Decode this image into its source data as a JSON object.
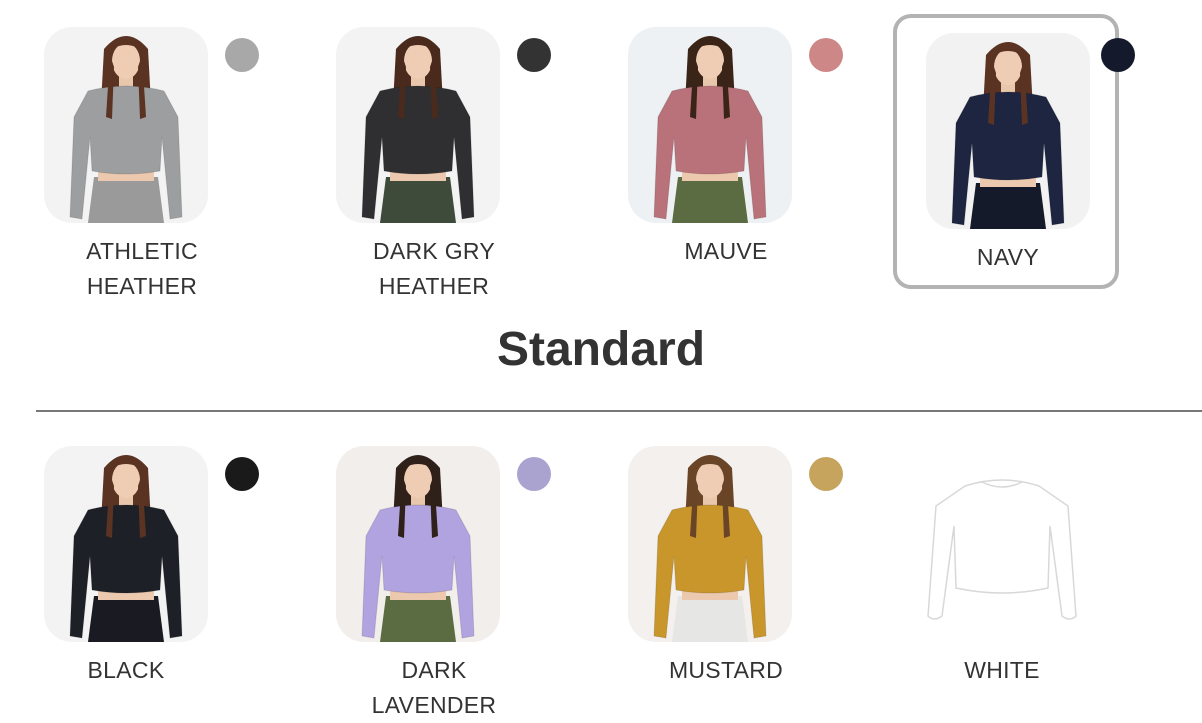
{
  "featured": [
    {
      "name": "ATHLETIC HEATHER",
      "line1": "ATHLETIC",
      "line2": "HEATHER",
      "swatch_color": "#a8a8a8",
      "shirt_color": "#9c9ea0",
      "bg": "#f3f3f3",
      "pants_color": "#9a9a9a",
      "hair": "#5a3322",
      "selected": false
    },
    {
      "name": "DARK GRY HEATHER",
      "line1": "DARK GRY",
      "line2": "HEATHER",
      "swatch_color": "#333333",
      "shirt_color": "#2f2f31",
      "bg": "#f3f3f3",
      "pants_color": "#3e4a3a",
      "hair": "#4a2a1c",
      "selected": false
    },
    {
      "name": "MAUVE",
      "line1": "MAUVE",
      "line2": "",
      "swatch_color": "#cd8787",
      "shirt_color": "#b9717a",
      "bg": "#edf1f4",
      "pants_color": "#5b6b42",
      "hair": "#3a2418",
      "selected": false
    },
    {
      "name": "NAVY",
      "line1": "NAVY",
      "line2": "",
      "swatch_color": "#141a2c",
      "shirt_color": "#1d2540",
      "bg": "#f2f2f2",
      "pants_color": "#151a2a",
      "hair": "#5a3322",
      "selected": true
    }
  ],
  "section": {
    "title": "Standard"
  },
  "standard": [
    {
      "name": "BLACK",
      "line1": "BLACK",
      "line2": "",
      "swatch_color": "#1a1a1a",
      "shirt_color": "#1e2028",
      "bg": "#f3f3f3",
      "pants_color": "#1a1b22",
      "hair": "#5a3322"
    },
    {
      "name": "DARK LAVENDER",
      "line1": "DARK",
      "line2": "LAVENDER",
      "swatch_color": "#aaa3cf",
      "shirt_color": "#b1a2e0",
      "bg": "#f1eeec",
      "pants_color": "#5b6b42",
      "hair": "#2f2119"
    },
    {
      "name": "MUSTARD",
      "line1": "MUSTARD",
      "line2": "",
      "swatch_color": "#c6a45e",
      "shirt_color": "#c8962a",
      "bg": "#f3f0ed",
      "pants_color": "#e6e6e4",
      "hair": "#6a4427"
    },
    {
      "name": "WHITE",
      "line1": "WHITE",
      "line2": "",
      "swatch_color": "#ffffff",
      "shirt_color": "#ffffff",
      "bg": "#ffffff",
      "pants_color": "#ffffff",
      "hair": "#ffffff"
    }
  ]
}
